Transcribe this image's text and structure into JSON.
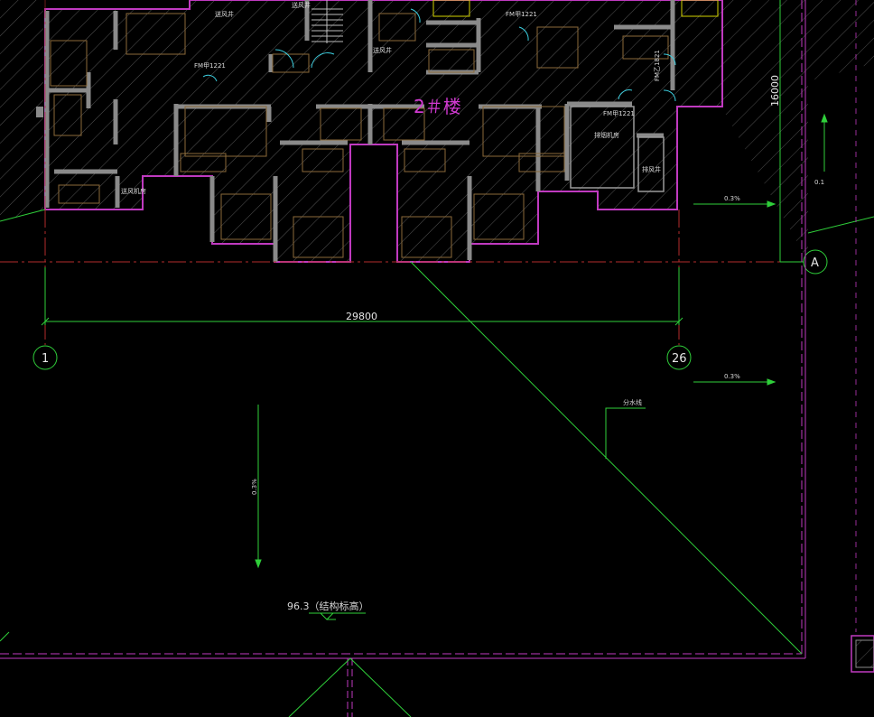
{
  "building_label": "2＃楼",
  "dimensions": {
    "horizontal": "29800",
    "vertical": "16000"
  },
  "grid_axes": {
    "left": "1",
    "right": "26",
    "row": "A"
  },
  "slope_labels": {
    "top_right": "0.3%",
    "mid_right": "0.3%",
    "center_vertical": "0.3%",
    "far_right_small": "0.1"
  },
  "water_divide_label": "分水线",
  "elevation_note": "96.3（结构标高）",
  "room_labels": {
    "fm_door_a": "FM甲1221",
    "fm_door_b": "FM甲1221",
    "fm_door_c": "FM甲1221",
    "fm_door_vertical": "FM乙1821",
    "smoke_well_left": "送风井",
    "smoke_well_mid": "送风井",
    "smoke_well_top": "送风井",
    "pipe_well": "排风井",
    "equipment_room": "排烟机房",
    "equipment_left": "送风机房"
  },
  "colors": {
    "background": "#000000",
    "wall": "#c03ac0",
    "hatch": "#6a6a6a",
    "green_line": "#2fcf3a",
    "grid_line": "#b52c2c",
    "pink_border": "#d23ad2"
  }
}
